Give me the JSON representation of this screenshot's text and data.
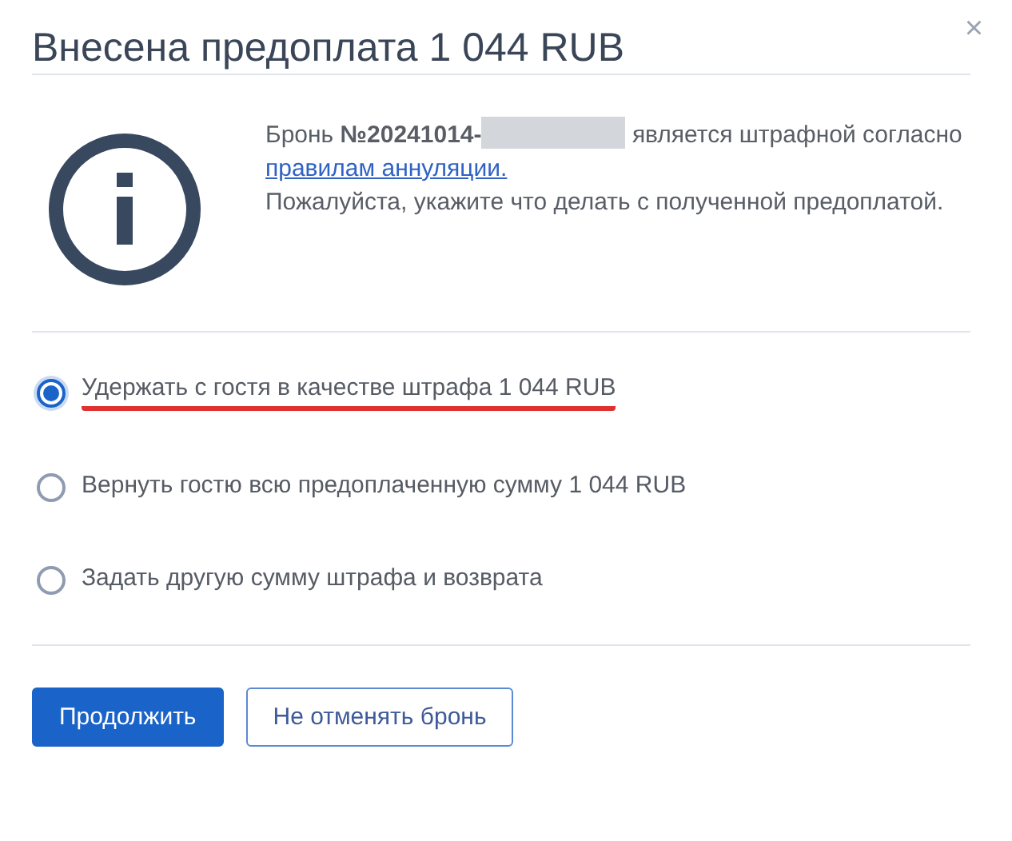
{
  "dialog": {
    "title": "Внесена предоплата 1 044 RUB",
    "close": "×"
  },
  "message": {
    "booking_prefix": "Бронь **№20241014-**",
    "redacted": true,
    "booking_suffix": "является штрафной согласно",
    "link": "правилам аннуляции.",
    "instruction": "Пожалуйста, укажите что делать с полученной предоплатой."
  },
  "options": [
    {
      "label": "Удержать с гостя в качестве штрафа 1 044 RUB",
      "selected": true,
      "underlined": true
    },
    {
      "label": "Вернуть гостю всю предоплаченную сумму 1 044 RUB",
      "selected": false,
      "underlined": false
    },
    {
      "label": "Задать другую сумму штрафа и возврата",
      "selected": false,
      "underlined": false
    }
  ],
  "buttons": [
    {
      "label": "Продолжить",
      "kind": "primary"
    },
    {
      "label": "Не отменять бронь",
      "kind": "secondary"
    }
  ]
}
